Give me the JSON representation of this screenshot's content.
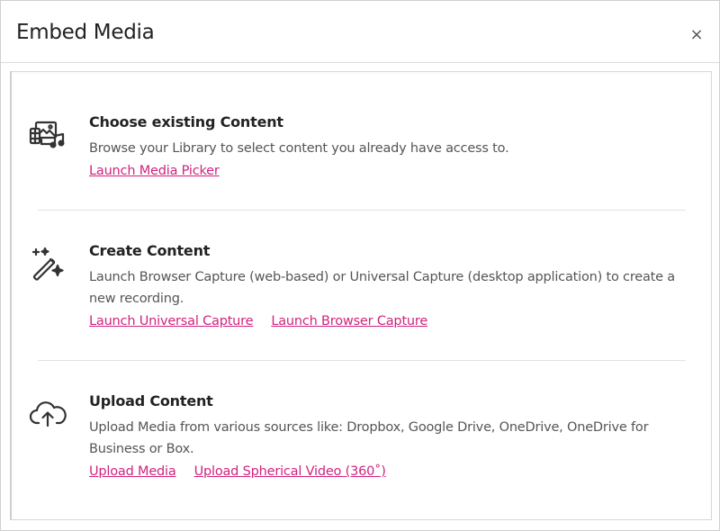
{
  "dialog": {
    "title": "Embed Media",
    "close_label": "×"
  },
  "sections": [
    {
      "icon": "media-library-icon",
      "heading": "Choose existing Content",
      "description": "Browse your Library to select content you already have access to.",
      "links": [
        "Launch Media Picker"
      ]
    },
    {
      "icon": "magic-wand-icon",
      "heading": "Create Content",
      "description": "Launch Browser Capture (web-based) or Universal Capture (desktop application) to create a new recording.",
      "links": [
        "Launch Universal Capture",
        "Launch Browser Capture"
      ]
    },
    {
      "icon": "cloud-upload-icon",
      "heading": "Upload Content",
      "description": "Upload Media from various sources like: Dropbox, Google Drive, OneDrive, OneDrive for Business or Box.",
      "links": [
        "Upload Media",
        "Upload Spherical Video (360˚)"
      ]
    }
  ],
  "colors": {
    "link": "#d0237f",
    "heading": "#222222",
    "text": "#555555",
    "border": "#d8d8d8"
  }
}
